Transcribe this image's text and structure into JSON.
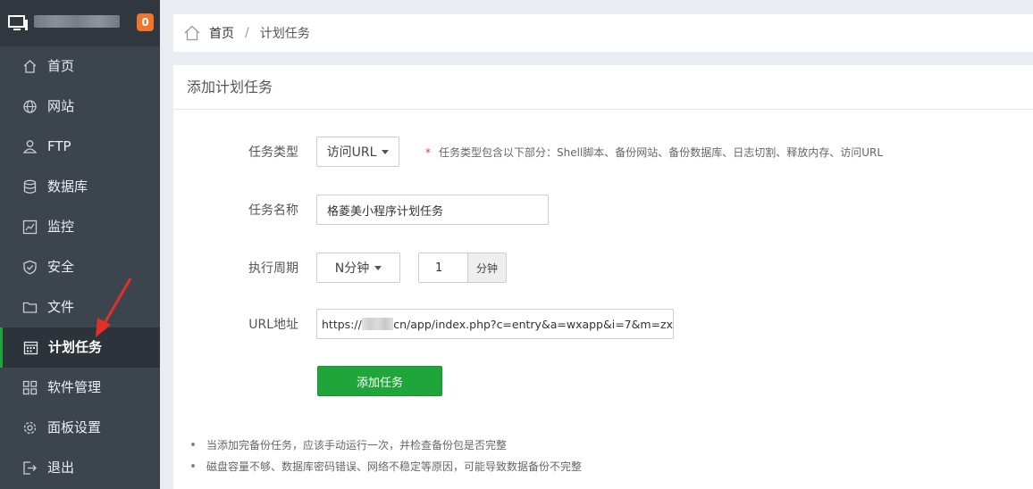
{
  "sidebar": {
    "badge": "0",
    "items": [
      {
        "label": "首页",
        "icon": "home-icon"
      },
      {
        "label": "网站",
        "icon": "globe-icon"
      },
      {
        "label": "FTP",
        "icon": "ftp-user-icon"
      },
      {
        "label": "数据库",
        "icon": "database-icon"
      },
      {
        "label": "监控",
        "icon": "monitor-chart-icon"
      },
      {
        "label": "安全",
        "icon": "shield-icon"
      },
      {
        "label": "文件",
        "icon": "folder-icon"
      },
      {
        "label": "计划任务",
        "icon": "calendar-icon",
        "active": true
      },
      {
        "label": "软件管理",
        "icon": "grid-icon"
      },
      {
        "label": "面板设置",
        "icon": "gear-icon"
      },
      {
        "label": "退出",
        "icon": "logout-icon"
      }
    ]
  },
  "breadcrumb": {
    "home": "首页",
    "separator": "/",
    "current": "计划任务"
  },
  "panel": {
    "title": "添加计划任务"
  },
  "form": {
    "task_type": {
      "label": "任务类型",
      "value": "访问URL",
      "note_star": "*",
      "note": "任务类型包含以下部分：Shell脚本、备份网站、备份数据库、日志切割、释放内存、访问URL"
    },
    "task_name": {
      "label": "任务名称",
      "value": "格菱美小程序计划任务"
    },
    "cycle": {
      "label": "执行周期",
      "value": "N分钟",
      "number": "1",
      "unit": "分钟"
    },
    "url": {
      "label": "URL地址",
      "value_prefix": "https://",
      "value_suffix": "cn/app/index.php?c=entry&a=wxapp&i=7&m=zx"
    },
    "submit_label": "添加任务"
  },
  "tips": [
    "当添加完备份任务，应该手动运行一次，并检查备份包是否完整",
    "磁盘容量不够、数据库密码错误、网络不稳定等原因，可能导致数据备份不完整"
  ],
  "colors": {
    "accent": "#20a53a",
    "sidebar_bg": "#3c444d",
    "badge": "#f0762b",
    "annotation_arrow": "#e0302a"
  }
}
